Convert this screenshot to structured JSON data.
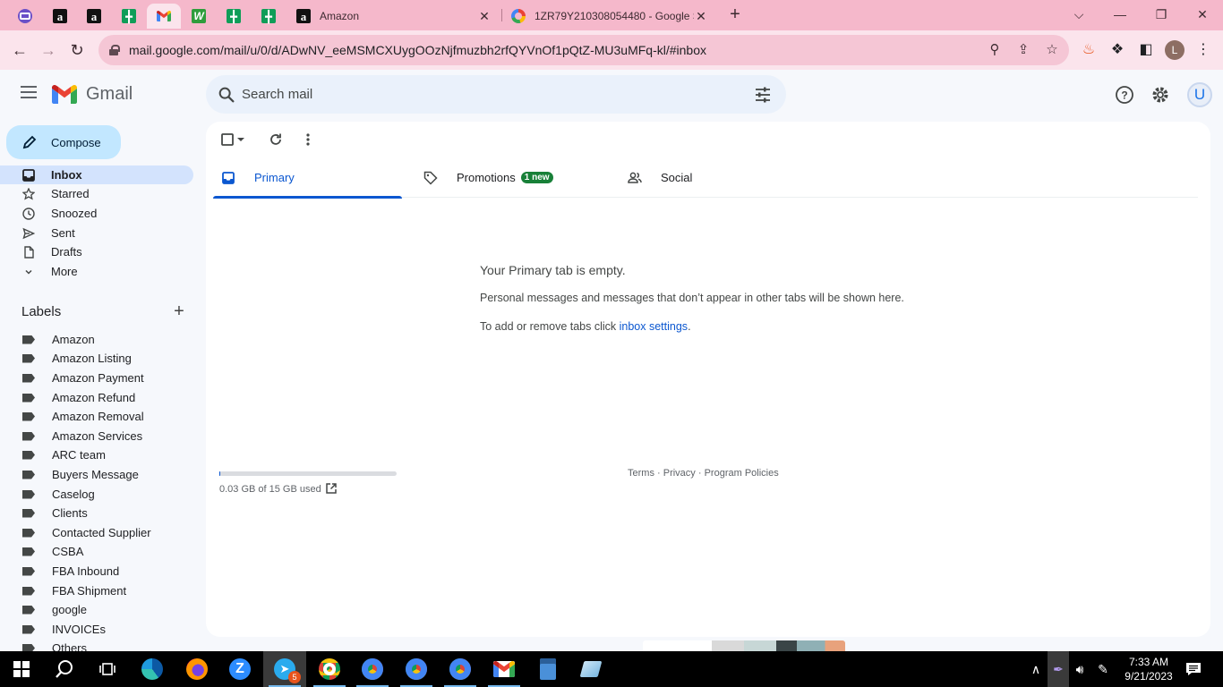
{
  "browser": {
    "tabs": [
      {
        "title": "Amazon"
      },
      {
        "title": "1ZR79Y210308054480 - Google S"
      }
    ],
    "url": "mail.google.com/mail/u/0/d/ADwNV_eeMSMCXUygOOzNjfmuzbh2rfQYVnOf1pQtZ-MU3uMFq-kl/#inbox",
    "profile_initial": "L"
  },
  "gmail": {
    "app_name": "Gmail",
    "search_placeholder": "Search mail",
    "account_initial": "U",
    "compose_label": "Compose",
    "nav": [
      {
        "label": "Inbox",
        "icon": "inbox-icon"
      },
      {
        "label": "Starred",
        "icon": "star-icon"
      },
      {
        "label": "Snoozed",
        "icon": "clock-icon"
      },
      {
        "label": "Sent",
        "icon": "send-icon"
      },
      {
        "label": "Drafts",
        "icon": "draft-icon"
      },
      {
        "label": "More",
        "icon": "chevron-down-icon"
      }
    ],
    "labels_title": "Labels",
    "labels": [
      "Amazon",
      "Amazon Listing",
      "Amazon Payment",
      "Amazon Refund",
      "Amazon Removal",
      "Amazon Services",
      "ARC team",
      "Buyers Message",
      "Caselog",
      "Clients",
      "Contacted Supplier",
      "CSBA",
      "FBA Inbound",
      "FBA Shipment",
      "google",
      "INVOICEs",
      "Others"
    ],
    "category_tabs": [
      {
        "label": "Primary",
        "icon": "inbox-icon"
      },
      {
        "label": "Promotions",
        "icon": "tag-icon",
        "badge": "1 new"
      },
      {
        "label": "Social",
        "icon": "people-icon"
      }
    ],
    "empty": {
      "title": "Your Primary tab is empty.",
      "line1": "Personal messages and messages that don’t appear in other tabs will be shown here.",
      "line2_prefix": "To add or remove tabs click ",
      "line2_link": "inbox settings",
      "line2_suffix": "."
    },
    "storage": {
      "text": "0.03 GB of 15 GB used",
      "fraction": 0.002
    },
    "footer": {
      "terms": "Terms",
      "privacy": "Privacy",
      "policies": "Program Policies",
      "sep": " · "
    }
  },
  "taskbar": {
    "telegram_badge": "5",
    "time": "7:33 AM",
    "date": "9/21/2023"
  },
  "colors": {
    "tabstrip": "#f5b8cb",
    "accent": "#0b57d0",
    "compose": "#c2e7ff",
    "selected_nav": "#d3e3fd",
    "badge": "#188038"
  }
}
